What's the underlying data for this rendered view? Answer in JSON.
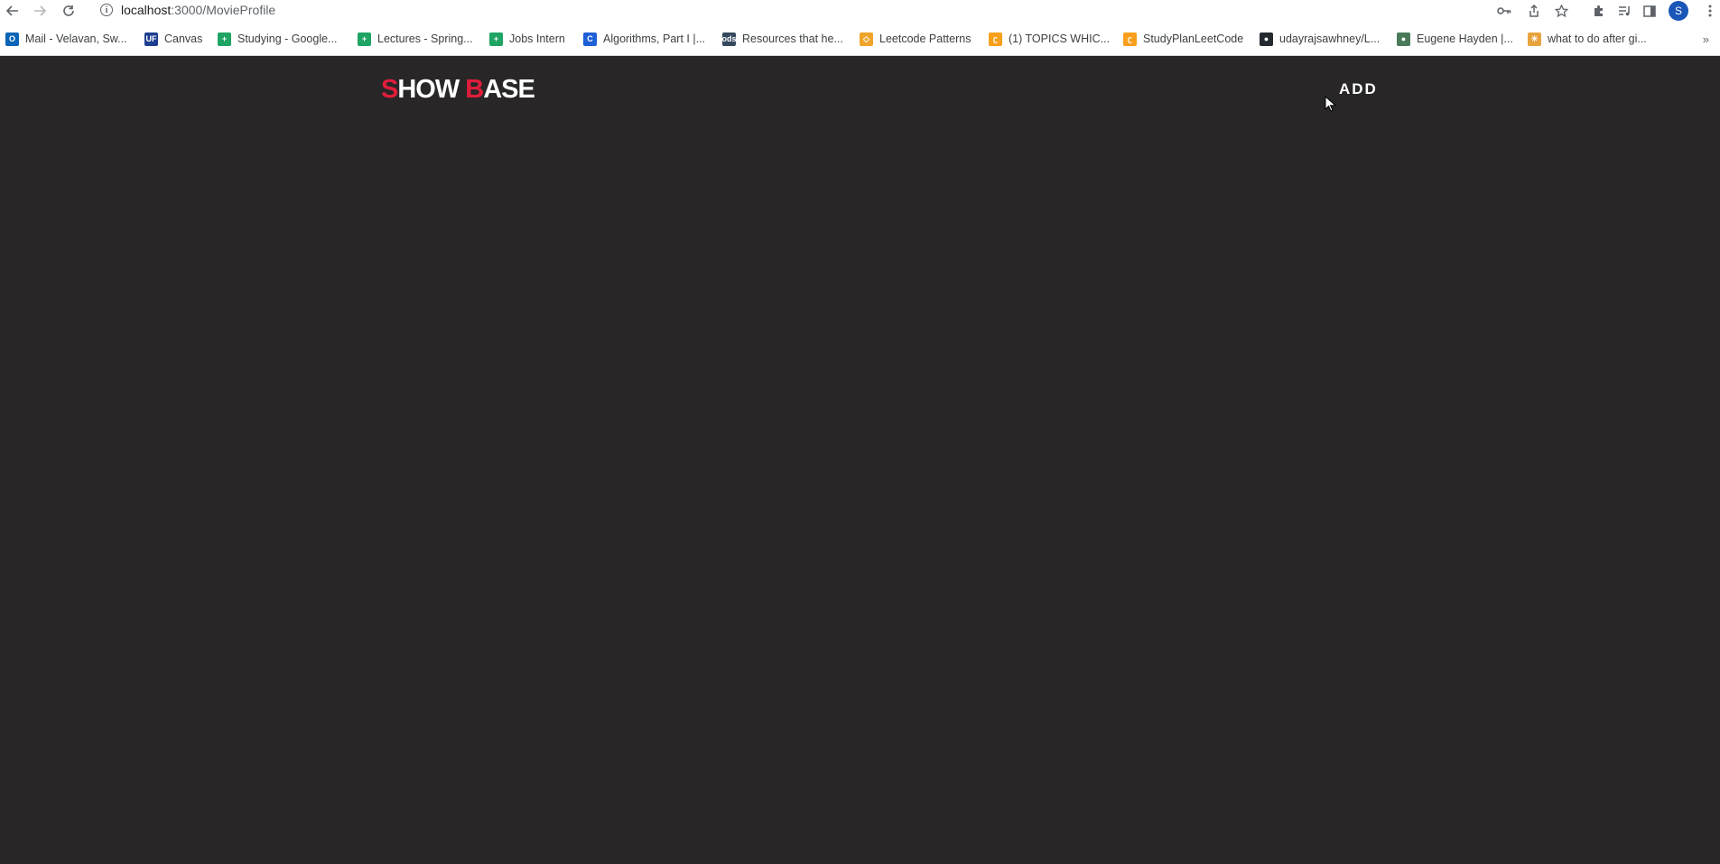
{
  "browser": {
    "url_host": "localhost",
    "url_path": ":3000/MovieProfile",
    "profile_initial": "S"
  },
  "bookmarks": [
    {
      "label": "Mail - Velavan, Sw...",
      "icon": "outlook-icon",
      "color": "#0a64b7",
      "glyph": "O"
    },
    {
      "label": "Canvas",
      "icon": "canvas-uf-icon",
      "color": "#1d3f8f",
      "glyph": "UF"
    },
    {
      "label": "Studying - Google...",
      "icon": "google-sheets-icon",
      "color": "#1fa463",
      "glyph": "+"
    },
    {
      "label": "Lectures - Spring...",
      "icon": "google-sheets-icon",
      "color": "#1fa463",
      "glyph": "+"
    },
    {
      "label": "Jobs Intern",
      "icon": "google-sheets-icon",
      "color": "#1fa463",
      "glyph": "+"
    },
    {
      "label": "Algorithms, Part I |...",
      "icon": "coursera-icon",
      "color": "#1d5fd6",
      "glyph": "C"
    },
    {
      "label": "Resources that he...",
      "icon": "ods-icon",
      "color": "#34495e",
      "glyph": "ods"
    },
    {
      "label": "Leetcode Patterns",
      "icon": "leetcode-patterns-icon",
      "color": "#f0a42b",
      "glyph": "◇"
    },
    {
      "label": "(1) TOPICS WHIC...",
      "icon": "leetcode-icon",
      "color": "#f89f1b",
      "glyph": "ʗ"
    },
    {
      "label": "StudyPlanLeetCode",
      "icon": "leetcode-icon",
      "color": "#f89f1b",
      "glyph": "ʗ"
    },
    {
      "label": "udayrajsawhney/L...",
      "icon": "github-icon",
      "color": "#24292f",
      "glyph": "●"
    },
    {
      "label": "Eugene Hayden |...",
      "icon": "profile-photo-icon",
      "color": "#4a7a5a",
      "glyph": "●"
    },
    {
      "label": "what to do after gi...",
      "icon": "sparkle-icon",
      "color": "#e8a33d",
      "glyph": "✳"
    }
  ],
  "app": {
    "logo_s": "S",
    "logo_how": "HOW ",
    "logo_b": "B",
    "logo_ase": "ASE",
    "add_label": "ADD",
    "accent_color": "#e11d3c",
    "background_color": "#282627"
  }
}
